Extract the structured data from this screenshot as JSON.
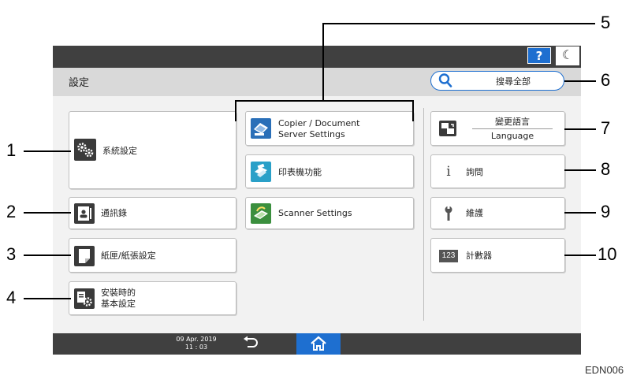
{
  "header": {
    "title": "設定",
    "search_label": "搜尋全部"
  },
  "topbar": {
    "help_label": "?"
  },
  "buttons": {
    "system_settings": "系統設定",
    "address_book": "通訊錄",
    "tray_paper": "紙匣/紙張設定",
    "install_line1": "安裝時的",
    "install_line2": "基本設定",
    "copier_line1": "Copier / Document",
    "copier_line2": "Server Settings",
    "printer": "印表機功能",
    "scanner": "Scanner Settings",
    "lang_line1": "變更語言",
    "lang_line2": "Language",
    "inquiry": "詢問",
    "maintenance": "維護",
    "counter": "計數器",
    "counter_badge": "123"
  },
  "status": {
    "date": "09 Apr. 2019",
    "time": "11 : 03"
  },
  "callouts": [
    "1",
    "2",
    "3",
    "4",
    "5",
    "6",
    "7",
    "8",
    "9",
    "10"
  ],
  "figure_code": "EDN006",
  "colors": {
    "accent": "#1e6fd0",
    "bar": "#404040",
    "header": "#d9d9d9",
    "content": "#f2f2f2"
  }
}
